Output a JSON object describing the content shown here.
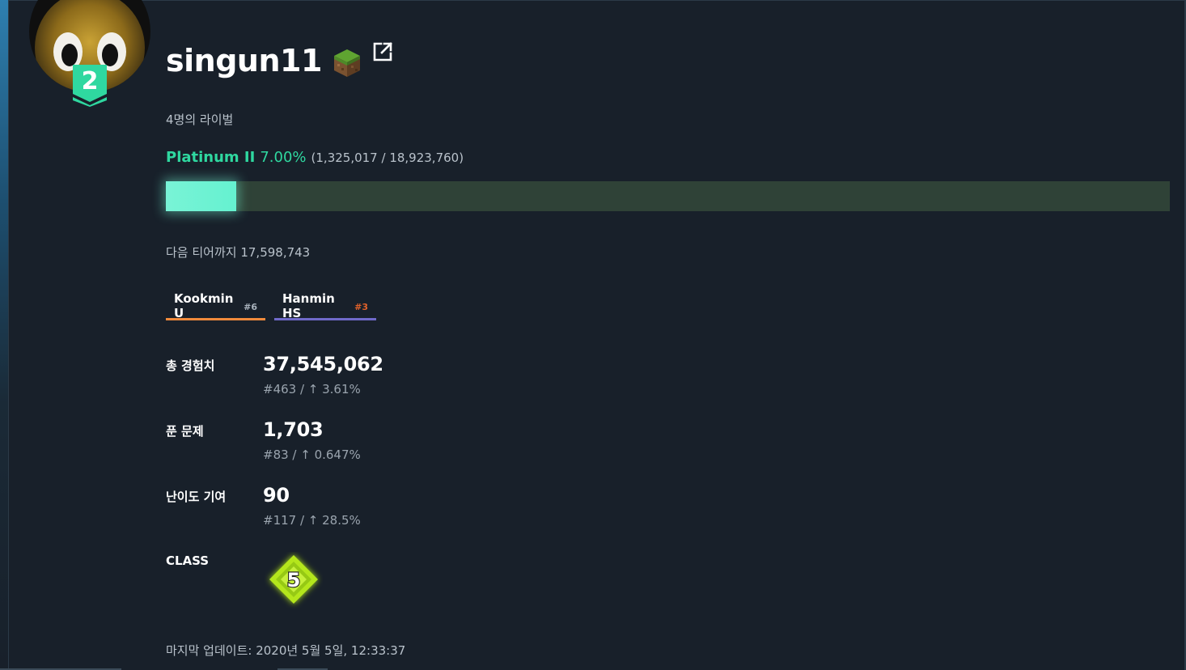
{
  "profile": {
    "username": "singun11",
    "tier_number": "2",
    "rivals_text": "4명의 라이벌"
  },
  "tier": {
    "name": "Platinum II",
    "percent_text": "7.00%",
    "progress_text": "(1,325,017 / 18,923,760)",
    "progress_fraction": 0.07,
    "next_tier_text": "다음 티어까지 17,598,743"
  },
  "organizations": [
    {
      "name": "Kookmin U",
      "rank": "#6"
    },
    {
      "name": "Hanmin HS",
      "rank": "#3"
    }
  ],
  "stats": {
    "exp": {
      "label": "총 경험치",
      "value": "37,545,062",
      "sub": "#463 / ↑ 3.61%"
    },
    "solved": {
      "label": "푼 문제",
      "value": "1,703",
      "sub": "#83 / ↑ 0.647%"
    },
    "contribution": {
      "label": "난이도 기여",
      "value": "90",
      "sub": "#117 / ↑ 28.5%"
    },
    "class": {
      "label": "CLASS",
      "value": "5"
    }
  },
  "last_updated": "마지막 업데이트: 2020년 5월 5일, 12:33:37",
  "icons": {
    "badge": "minecraft-grass-block-icon",
    "external": "external-link-icon",
    "arrow": "arrow-up-icon"
  },
  "colors": {
    "tier": "#2fd8a0",
    "bar_fill": "#6ff3d3",
    "bar_track": "#2f4237",
    "kookmin": "#f08a3c",
    "hanmin": "#6f69c9",
    "hanmin_rank": "#e0612a",
    "class_badge": "#b4e61c"
  }
}
